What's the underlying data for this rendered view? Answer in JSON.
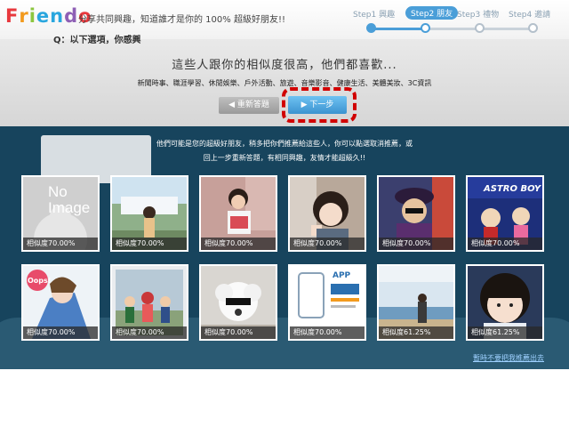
{
  "header": {
    "logo_letters": [
      {
        "ch": "F",
        "color": "#e8383d"
      },
      {
        "ch": "r",
        "color": "#f29a1d"
      },
      {
        "ch": "i",
        "color": "#8cc63f"
      },
      {
        "ch": "e",
        "color": "#29a6de"
      },
      {
        "ch": "n",
        "color": "#29a6de"
      },
      {
        "ch": "d",
        "color": "#8e5fb5"
      },
      {
        "ch": "o",
        "color": "#e8383d"
      }
    ],
    "tagline": "分享共同興趣，知道誰才是你的 100% 超級好朋友!!"
  },
  "steps": [
    {
      "label": "Step1 興趣",
      "state": "done"
    },
    {
      "label": "Step2 朋友",
      "state": "active"
    },
    {
      "label": "Step3 禮物",
      "state": "todo"
    },
    {
      "label": "Step4 邀請",
      "state": "todo"
    }
  ],
  "banner": {
    "headline": "這些人跟你的相似度很高，他們都喜歡...",
    "categories": "新聞時事、職涯學習、休閒娛樂、戶外活動、旅遊、音樂影音、健康生活、美體美妝、3C資訊",
    "reanswer_label": "◀ 重新答題",
    "next_label": "▶ 下一步"
  },
  "main": {
    "hint": "Q：以下選項，你感興",
    "desc1": "他們可能是您的超級好朋友，稍多把你們推薦給這些人，你可以點選取消推薦，或",
    "desc2": "回上一步重新答題，有相同興趣，友情才能超級久!!",
    "noimage_line1": "No",
    "noimage_line2": "Image"
  },
  "friends": [
    {
      "similarity": "相似度70.00%",
      "photo": "no-image"
    },
    {
      "similarity": "相似度70.00%",
      "photo": "girl-waterfall"
    },
    {
      "similarity": "相似度70.00%",
      "photo": "boy-sign"
    },
    {
      "similarity": "相似度70.00%",
      "photo": "girl-selfie"
    },
    {
      "similarity": "相似度70.00%",
      "photo": "hat-portrait"
    },
    {
      "similarity": "相似度70.00%",
      "photo": "astro-boy"
    },
    {
      "similarity": "相似度70.00%",
      "photo": "oops-drawing"
    },
    {
      "similarity": "相似度70.00%",
      "photo": "group-photo"
    },
    {
      "similarity": "相似度70.00%",
      "photo": "white-dog"
    },
    {
      "similarity": "相似度70.00%",
      "photo": "app-poster"
    },
    {
      "similarity": "相似度61.25%",
      "photo": "beach-person"
    },
    {
      "similarity": "相似度61.25%",
      "photo": "girl-bangs"
    }
  ],
  "astro_text": "ASTRO BOY",
  "app_text": "APP",
  "oops_text": "Oops!",
  "exit_link": "暫時不要把我推薦出去",
  "colors": {
    "accent": "#4a9ed8",
    "main_bg": "#17445d",
    "highlight": "#d10000"
  }
}
